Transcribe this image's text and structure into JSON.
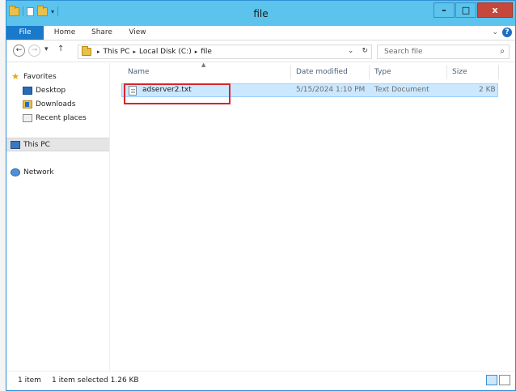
{
  "window": {
    "title": "file"
  },
  "title_buttons": {
    "minimize": "–",
    "maximize": "□",
    "close": "x"
  },
  "ribbon": {
    "tabs": [
      "File",
      "Home",
      "Share",
      "View"
    ],
    "expand_glyph": "⌄",
    "help_glyph": "?"
  },
  "address": {
    "back_glyph": "←",
    "forward_glyph": "→",
    "recent_glyph": "▾",
    "up_glyph": "↑",
    "breadcrumbs": [
      "This PC",
      "Local Disk (C:)",
      "file"
    ],
    "crumb_separator": "▸",
    "dropdown_glyph": "⌄",
    "refresh_glyph": "↻"
  },
  "search": {
    "placeholder": "Search file",
    "icon_glyph": "⌕"
  },
  "nav_pane": {
    "favorites": "Favorites",
    "items": [
      "Desktop",
      "Downloads",
      "Recent places"
    ],
    "this_pc": "This PC",
    "network": "Network"
  },
  "file_list": {
    "columns": [
      "Name",
      "Date modified",
      "Type",
      "Size"
    ],
    "sort_glyph": "▲",
    "rows": [
      {
        "name": "adserver2.txt",
        "date_modified": "5/15/2024 1:10 PM",
        "type": "Text Document",
        "size": "2 KB",
        "selected": true
      }
    ]
  },
  "status_bar": {
    "item_count": "1 item",
    "selection": "1 item selected  1.26 KB"
  },
  "icons": [
    "folder-icon",
    "document-icon",
    "star-icon",
    "desktop-icon",
    "downloads-icon",
    "recent-places-icon",
    "computer-icon",
    "network-icon",
    "text-file-icon",
    "search-icon",
    "refresh-icon",
    "help-icon"
  ],
  "colors": {
    "title_bar": "#5bc3ec",
    "file_tab": "#1979ca",
    "close_button": "#c7473b",
    "selection": "#cce8ff",
    "highlight_box": "#d6262a"
  }
}
